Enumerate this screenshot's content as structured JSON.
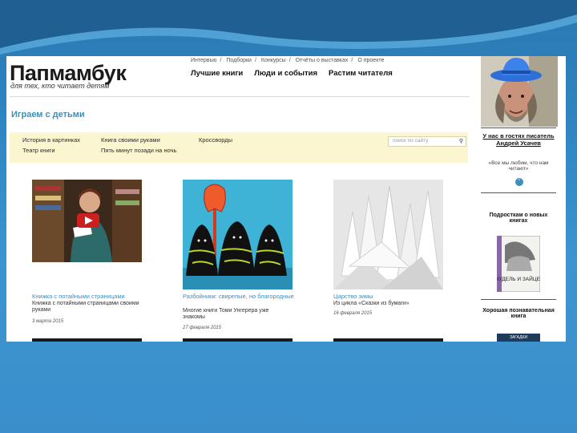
{
  "site": {
    "logo": "Папмамбук",
    "tagline": "для тех, кто читает детям",
    "breadcrumbs": [
      "Интервью",
      "Подборки",
      "Конкурсы",
      "Отчёты о выставках",
      "О проекте"
    ],
    "main_nav": [
      "Лучшие книги",
      "Люди и события",
      "Растим читателя"
    ]
  },
  "section_title": "Играем с детьми",
  "subnav": {
    "items": [
      "История в картинках",
      "Театр книги",
      "Книга своими руками",
      "Пять минут позади на ночь",
      "Кроссворды"
    ],
    "search_placeholder": "поиск по сайту",
    "search_icon": "magnifier-icon"
  },
  "cards": [
    {
      "title": "Книжка с потайными страницами",
      "desc": "Книжка с потайными страницами своими руками",
      "date": "3 марта 2015"
    },
    {
      "title": "Разбойники: свирепые, но благородные",
      "desc": "Многие книги Томи Унгерера уже знакомы",
      "date": "27 февраля 2015"
    },
    {
      "title": "Царство зимы",
      "desc": "Из цикла «Сказки из бумаги»",
      "date": "16 февраля 2015"
    }
  ],
  "sidebar": {
    "guest_title": "У нас в гостях писатель Андрей Усачев",
    "guest_quote": "«Все мы любим, что нам читают»",
    "new_books": "Подросткам о новых книгах",
    "book_cover_title": "НУДЕЛЬ И ЗАЙЦЕВ",
    "good_book": "Хорошая познавательная книга",
    "bottom_cover": "ЗАГАДКИ"
  },
  "colors": {
    "accent": "#3a8fc0",
    "subnav_bg": "#fbf6cf",
    "page_bg": "#2f86c2"
  }
}
